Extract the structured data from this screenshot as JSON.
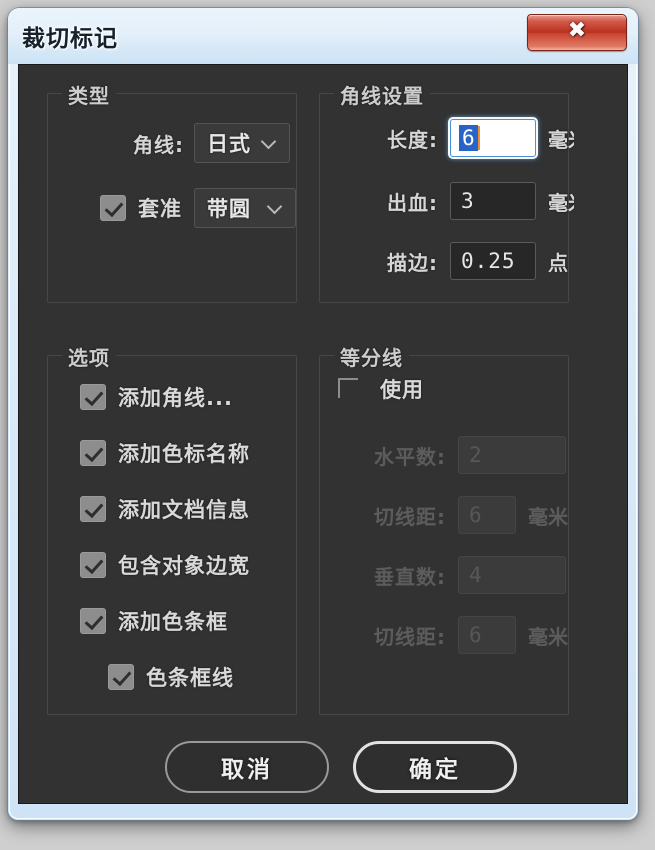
{
  "window": {
    "title": "裁切标记",
    "close_label": "✖",
    "close_icon": "close-icon"
  },
  "groups": {
    "type": {
      "legend": "类型",
      "corner_line": {
        "label": "角线:",
        "value": "日式",
        "arrow_icon": "chevron-down-icon"
      },
      "registration": {
        "checkbox_label": "套准",
        "checked": true,
        "value": "带圆",
        "arrow_icon": "chevron-down-icon"
      }
    },
    "corner_settings": {
      "legend": "角线设置",
      "rows": [
        {
          "label": "长度:",
          "value": "6",
          "unit": "毫米",
          "focused": true,
          "disabled": false
        },
        {
          "label": "出血:",
          "value": "3",
          "unit": "毫米",
          "focused": false,
          "disabled": false
        },
        {
          "label": "描边:",
          "value": "0.25",
          "unit": "点",
          "focused": false,
          "disabled": false
        }
      ]
    },
    "options": {
      "legend": "选项",
      "items": [
        {
          "label": "添加角线...",
          "checked": true,
          "indent": false
        },
        {
          "label": "添加色标名称",
          "checked": true,
          "indent": false
        },
        {
          "label": "添加文档信息",
          "checked": true,
          "indent": false
        },
        {
          "label": "包含对象边宽",
          "checked": true,
          "indent": false
        },
        {
          "label": "添加色条框",
          "checked": true,
          "indent": false
        },
        {
          "label": "色条框线",
          "checked": true,
          "indent": true
        }
      ]
    },
    "divider_lines": {
      "legend": "等分线",
      "use": {
        "label": "使用",
        "checked": false
      },
      "rows": [
        {
          "label": "水平数:",
          "value": "2",
          "unit": ""
        },
        {
          "label": "切线距:",
          "value": "6",
          "unit": "毫米"
        },
        {
          "label": "垂直数:",
          "value": "4",
          "unit": ""
        },
        {
          "label": "切线距:",
          "value": "6",
          "unit": "毫米"
        }
      ],
      "disabled": true
    }
  },
  "footer": {
    "cancel_label": "取消",
    "ok_label": "确定"
  },
  "colors": {
    "dialog_bg": "#323232",
    "title_bar": "#dbeaf8",
    "close_button": "#b8301f",
    "field_bg": "#272727",
    "focus_highlight": "#2864c8",
    "text": "#d8d8d8",
    "text_disabled": "#5c5c5c"
  }
}
